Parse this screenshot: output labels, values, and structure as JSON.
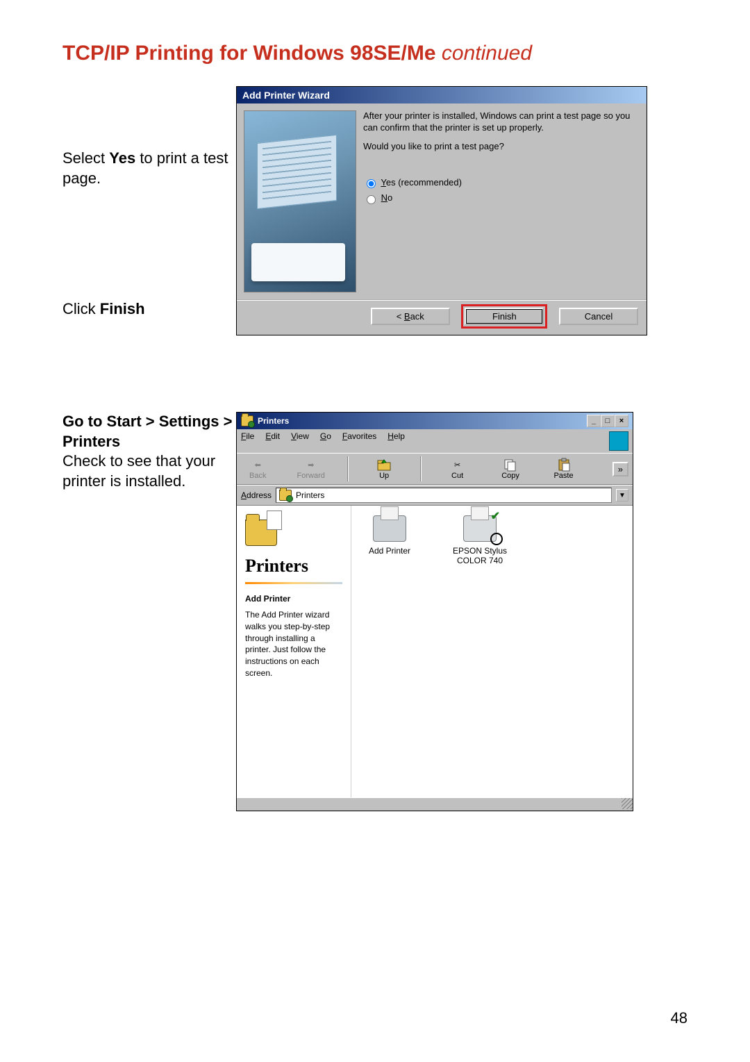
{
  "heading": {
    "main": "TCP/IP Printing for Windows 98SE/Me ",
    "cont": "continued"
  },
  "section1": {
    "instr1a": "Select ",
    "instr1b": "Yes",
    "instr1c": " to print a test page.",
    "instr2a": "Click ",
    "instr2b": "Finish"
  },
  "wizard": {
    "title": "Add Printer Wizard",
    "p1": "After your printer is installed, Windows can print a test page so you can confirm that the printer is set up properly.",
    "p2": "Would you like to print a test page?",
    "opt_yes_pre": "Y",
    "opt_yes": "es (recommended)",
    "opt_no_pre": "N",
    "opt_no": "o",
    "back_pre": "< ",
    "back_u": "B",
    "back": "ack",
    "finish": "Finish",
    "cancel": "Cancel"
  },
  "section2": {
    "line1": "Go to Start > Settings > Printers",
    "line2": "Check to see that your printer is installed."
  },
  "pwin": {
    "title": "Printers",
    "menu": {
      "file_u": "F",
      "file": "ile",
      "edit_u": "E",
      "edit": "dit",
      "view_u": "V",
      "view": "iew",
      "go_u": "G",
      "go": "o",
      "fav": "F",
      "fav2": "avorites",
      "help_u": "H",
      "help": "elp"
    },
    "tool": {
      "back": "Back",
      "forward": "Forward",
      "up": "Up",
      "cut": "Cut",
      "copy": "Copy",
      "paste": "Paste",
      "more": "»"
    },
    "addr_label_u": "A",
    "addr_label": "ddress",
    "addr_value": "Printers",
    "left": {
      "heading": "Printers",
      "sub": "Add Printer",
      "desc": "The Add Printer wizard walks you step-by-step through installing a printer. Just follow the instructions on each screen."
    },
    "items": {
      "add": "Add Printer",
      "p1a": "EPSON Stylus",
      "p1b": "COLOR 740"
    }
  },
  "page_number": "48"
}
